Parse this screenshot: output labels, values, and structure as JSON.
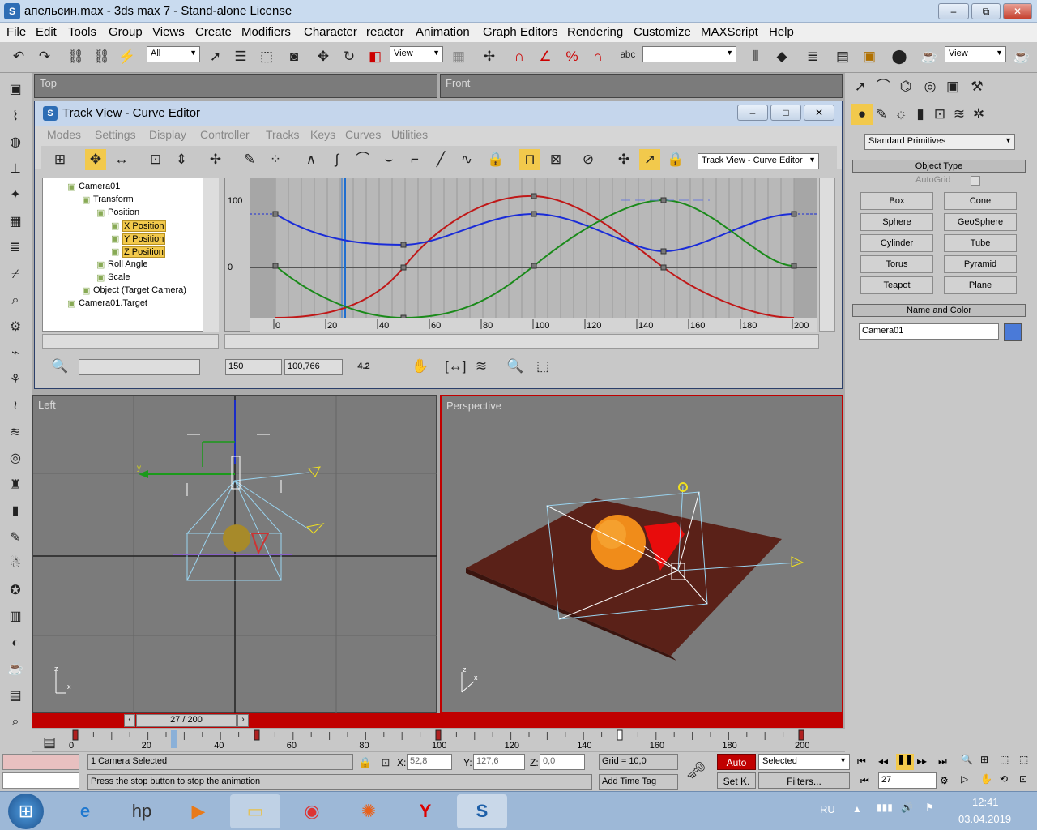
{
  "window": {
    "title": "апельсин.max - 3ds max 7  - Stand-alone License",
    "minimize": "‒",
    "restore": "⧉",
    "close": "✕"
  },
  "menu": [
    "File",
    "Edit",
    "Tools",
    "Group",
    "Views",
    "Create",
    "Modifiers",
    "Character",
    "reactor",
    "Animation",
    "Graph Editors",
    "Rendering",
    "Customize",
    "MAXScript",
    "Help"
  ],
  "toolbar": {
    "selection_filter": "All",
    "ref_coord": "View",
    "ref_coord2": "View",
    "named_sel": ""
  },
  "viewports": {
    "top": "Top",
    "front": "Front",
    "left": "Left",
    "perspective": "Perspective"
  },
  "trackview": {
    "title": "Track View - Curve Editor",
    "menu": [
      "Modes",
      "Settings",
      "Display",
      "Controller",
      "Tracks",
      "Keys",
      "Curves",
      "Utilities"
    ],
    "name_field": "Track View - Curve Editor",
    "tree": [
      {
        "label": "Camera01",
        "depth": 0,
        "selected": false
      },
      {
        "label": "Transform",
        "depth": 1,
        "selected": false
      },
      {
        "label": "Position",
        "depth": 2,
        "selected": false
      },
      {
        "label": "X Position",
        "depth": 3,
        "selected": true
      },
      {
        "label": "Y Position",
        "depth": 3,
        "selected": true
      },
      {
        "label": "Z Position",
        "depth": 3,
        "selected": true
      },
      {
        "label": "Roll Angle",
        "depth": 2,
        "selected": false
      },
      {
        "label": "Scale",
        "depth": 2,
        "selected": false
      },
      {
        "label": "Object (Target Camera)",
        "depth": 1,
        "selected": false
      },
      {
        "label": "Camera01.Target",
        "depth": 0,
        "selected": false
      }
    ],
    "y_ticks": [
      "100",
      "0"
    ],
    "x_ticks": [
      "0",
      "20",
      "40",
      "60",
      "80",
      "100",
      "120",
      "140",
      "160",
      "180",
      "200"
    ],
    "frame_field": "150",
    "value_field": "100,766",
    "angle_label": "4.2"
  },
  "command_panel": {
    "dropdown": "Standard Primitives",
    "object_type_title": "Object Type",
    "autogrid": "AutoGrid",
    "primitives": [
      "Box",
      "Cone",
      "Sphere",
      "GeoSphere",
      "Cylinder",
      "Tube",
      "Torus",
      "Pyramid",
      "Teapot",
      "Plane"
    ],
    "name_color_title": "Name and Color",
    "object_name": "Camera01",
    "object_color": "#4a7ad8"
  },
  "timeline": {
    "slider_label": "27 / 200",
    "ticks": [
      "0",
      "20",
      "40",
      "60",
      "80",
      "100",
      "120",
      "140",
      "160",
      "180",
      "200"
    ],
    "current_frame": 27
  },
  "statusbar": {
    "selection": "1 Camera Selected",
    "prompt": "Press the stop button to stop the animation",
    "x_label": "X:",
    "x_value": "52,8",
    "y_label": "Y:",
    "y_value": "127,6",
    "z_label": "Z:",
    "z_value": "0,0",
    "grid": "Grid = 10,0",
    "add_time_tag": "Add Time Tag",
    "auto": "Auto",
    "set_key": "Set K.",
    "key_filter": "Selected",
    "filters": "Filters...",
    "frame": "27"
  },
  "taskbar": {
    "lang": "RU",
    "time": "12:41",
    "date": "03.04.2019"
  }
}
